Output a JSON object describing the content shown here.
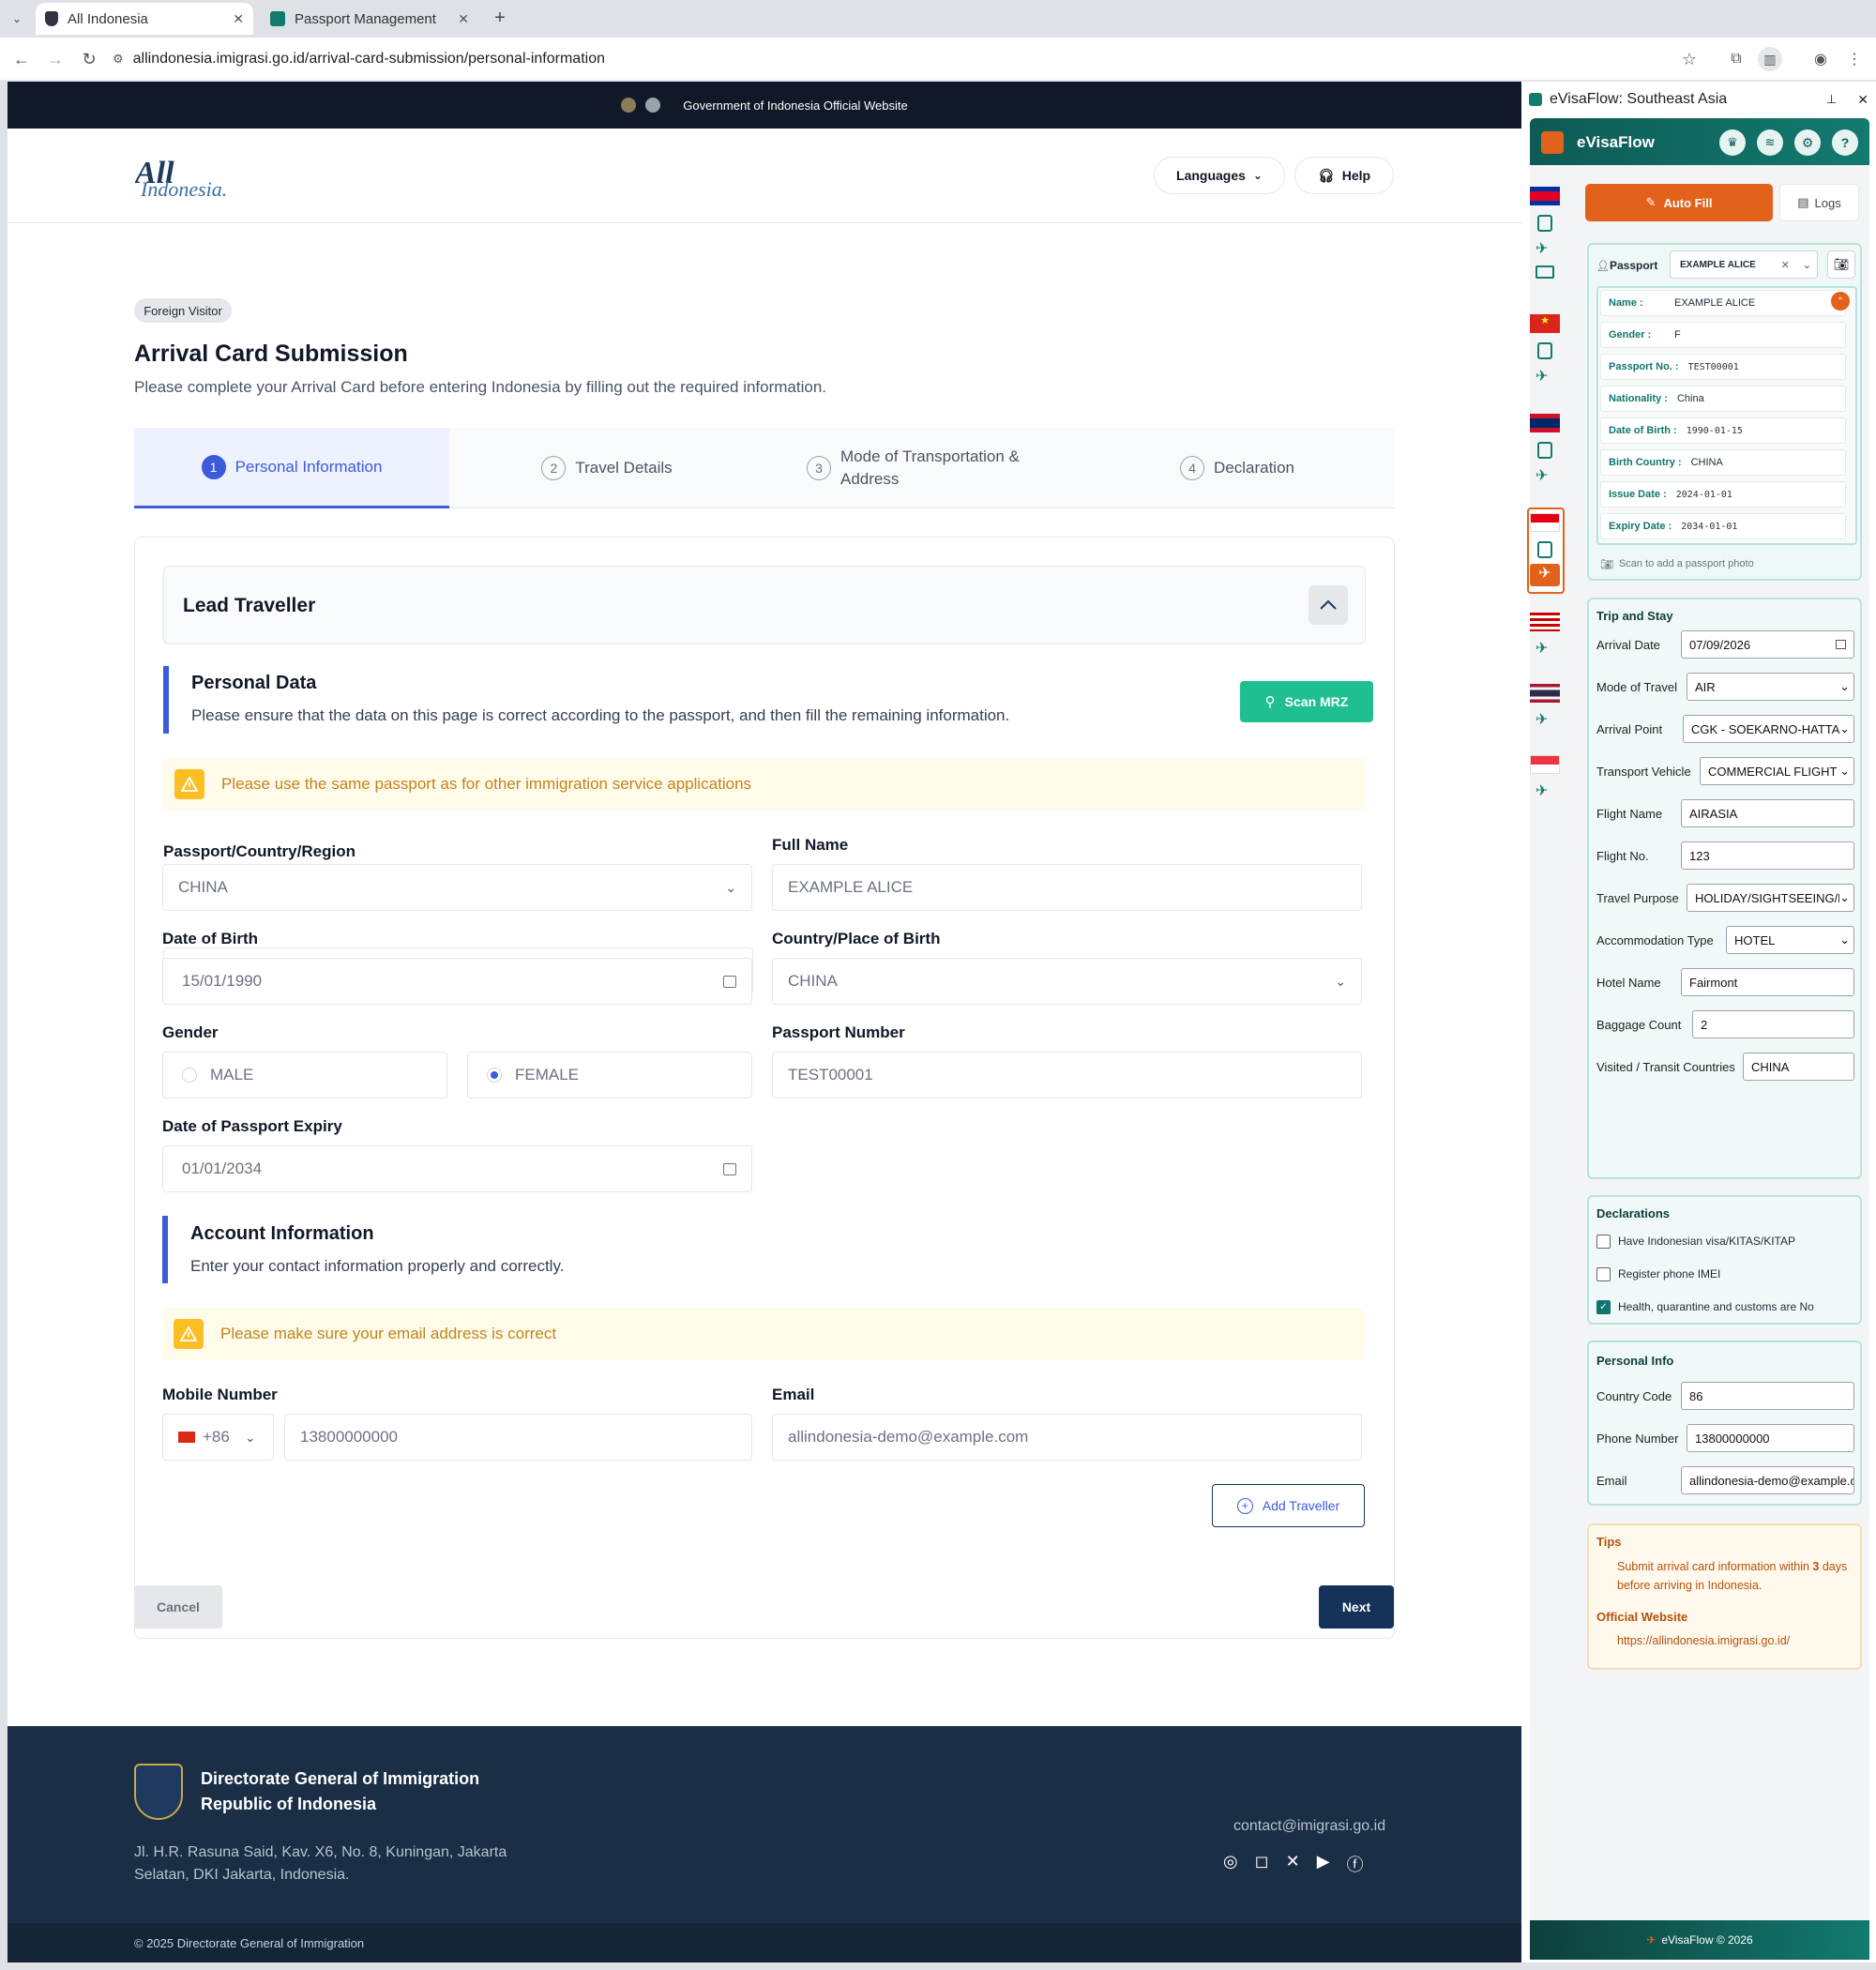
{
  "browser": {
    "tabs": [
      {
        "title": "All Indonesia"
      },
      {
        "title": "Passport Management"
      }
    ],
    "url": "allindonesia.imigrasi.go.id/arrival-card-submission/personal-information"
  },
  "page": {
    "gov_banner": "Government of Indonesia Official Website",
    "logo_text": "All Indonesia",
    "languages_label": "Languages",
    "help_label": "Help",
    "badge": "Foreign Visitor",
    "title": "Arrival Card Submission",
    "subtitle": "Please complete your Arrival Card before entering Indonesia by filling out the required information.",
    "steps": [
      {
        "num": "1",
        "label": "Personal Information"
      },
      {
        "num": "2",
        "label": "Travel Details"
      },
      {
        "num": "3",
        "label": "Mode of Transportation & Address"
      },
      {
        "num": "4",
        "label": "Declaration"
      }
    ],
    "lead_traveller": "Lead Traveller",
    "personal_data": {
      "title": "Personal Data",
      "desc": "Please ensure that the data on this page is correct according to the passport, and then fill the remaining information.",
      "scan_label": "Scan MRZ",
      "warning": "Please use the same passport as for other immigration service applications"
    },
    "form": {
      "passport_country": {
        "label": "Passport/Country/Region",
        "value": "CHINA"
      },
      "full_name": {
        "label": "Full Name",
        "value": "EXAMPLE ALICE"
      },
      "dob": {
        "label": "Date of Birth",
        "value": "15/01/1990"
      },
      "birth_place": {
        "label": "Country/Place of Birth",
        "value": "CHINA"
      },
      "gender": {
        "label": "Gender",
        "male": "MALE",
        "female": "FEMALE"
      },
      "passport_no": {
        "label": "Passport Number",
        "value": "TEST00001"
      },
      "expiry": {
        "label": "Date of Passport Expiry",
        "value": "01/01/2034"
      }
    },
    "account": {
      "title": "Account Information",
      "desc": "Enter your contact information properly and correctly.",
      "warning": "Please make sure your email address is correct",
      "mobile_label": "Mobile Number",
      "code": "+86",
      "mobile": "13800000000",
      "email_label": "Email",
      "email": "allindonesia-demo@example.com"
    },
    "add_traveller": "Add Traveller",
    "cancel": "Cancel",
    "next": "Next",
    "footer": {
      "org1": "Directorate General of Immigration",
      "org2": "Republic of Indonesia",
      "addr1": "Jl. H.R. Rasuna Said, Kav. X6, No. 8, Kuningan, Jakarta",
      "addr2": "Selatan, DKI Jakarta, Indonesia.",
      "contact": "contact@imigrasi.go.id",
      "copyright": "© 2025 Directorate General of Immigration"
    }
  },
  "ext": {
    "panel_title": "eVisaFlow: Southeast Asia",
    "brand": "eVisaFlow",
    "autofill": "Auto Fill",
    "logs": "Logs",
    "passport_label": "Passport",
    "passport_select": "EXAMPLE ALICE",
    "passport_rows": [
      {
        "k": "Name :",
        "v": "EXAMPLE ALICE"
      },
      {
        "k": "Gender :",
        "v": "F"
      },
      {
        "k": "Passport No. :",
        "v": "TEST00001"
      },
      {
        "k": "Nationality :",
        "v": "China"
      },
      {
        "k": "Date of Birth :",
        "v": "1990-01-15"
      },
      {
        "k": "Birth Country :",
        "v": "CHINA"
      },
      {
        "k": "Issue Date :",
        "v": "2024-01-01"
      },
      {
        "k": "Expiry Date :",
        "v": "2034-01-01"
      }
    ],
    "scan_hint": "Scan to add a passport photo",
    "trip": {
      "title": "Trip and Stay",
      "rows": [
        {
          "k": "Arrival Date",
          "v": "07/09/2026"
        },
        {
          "k": "Mode of Travel",
          "v": "AIR"
        },
        {
          "k": "Arrival Point",
          "v": "CGK - SOEKARNO-HATTA AIRPORT"
        },
        {
          "k": "Transport Vehicle",
          "v": "COMMERCIAL FLIGHT"
        },
        {
          "k": "Flight Name",
          "v": "AIRASIA"
        },
        {
          "k": "Flight No.",
          "v": "123"
        },
        {
          "k": "Travel Purpose",
          "v": "HOLIDAY/SIGHTSEEING/LEISURE"
        },
        {
          "k": "Accommodation Type",
          "v": "HOTEL"
        },
        {
          "k": "Hotel Name",
          "v": "Fairmont"
        },
        {
          "k": "Baggage Count",
          "v": "2"
        },
        {
          "k": "Visited / Transit Countries",
          "v": "CHINA"
        }
      ]
    },
    "declarations": {
      "title": "Declarations",
      "items": [
        {
          "label": "Have Indonesian visa/KITAS/KITAP",
          "checked": false
        },
        {
          "label": "Register phone IMEI",
          "checked": false
        },
        {
          "label": "Health, quarantine and customs are No",
          "checked": true
        }
      ]
    },
    "personal": {
      "title": "Personal Info",
      "rows": [
        {
          "k": "Country Code",
          "v": "86"
        },
        {
          "k": "Phone Number",
          "v": "13800000000"
        },
        {
          "k": "Email",
          "v": "allindonesia-demo@example.com"
        }
      ]
    },
    "tips": {
      "title": "Tips",
      "text1": "Submit arrival card information within ",
      "text_bold": "3",
      "text2": " days before arriving in Indonesia.",
      "official_title": "Official Website",
      "official_url": "https://allindonesia.imigrasi.go.id/"
    },
    "footer": "eVisaFlow © 2026"
  },
  "colors": {
    "accent": "#3b5bdb",
    "navy": "#14325a",
    "teal": "#0f766e",
    "orange": "#e2621b",
    "scan": "#1fbf8f"
  }
}
